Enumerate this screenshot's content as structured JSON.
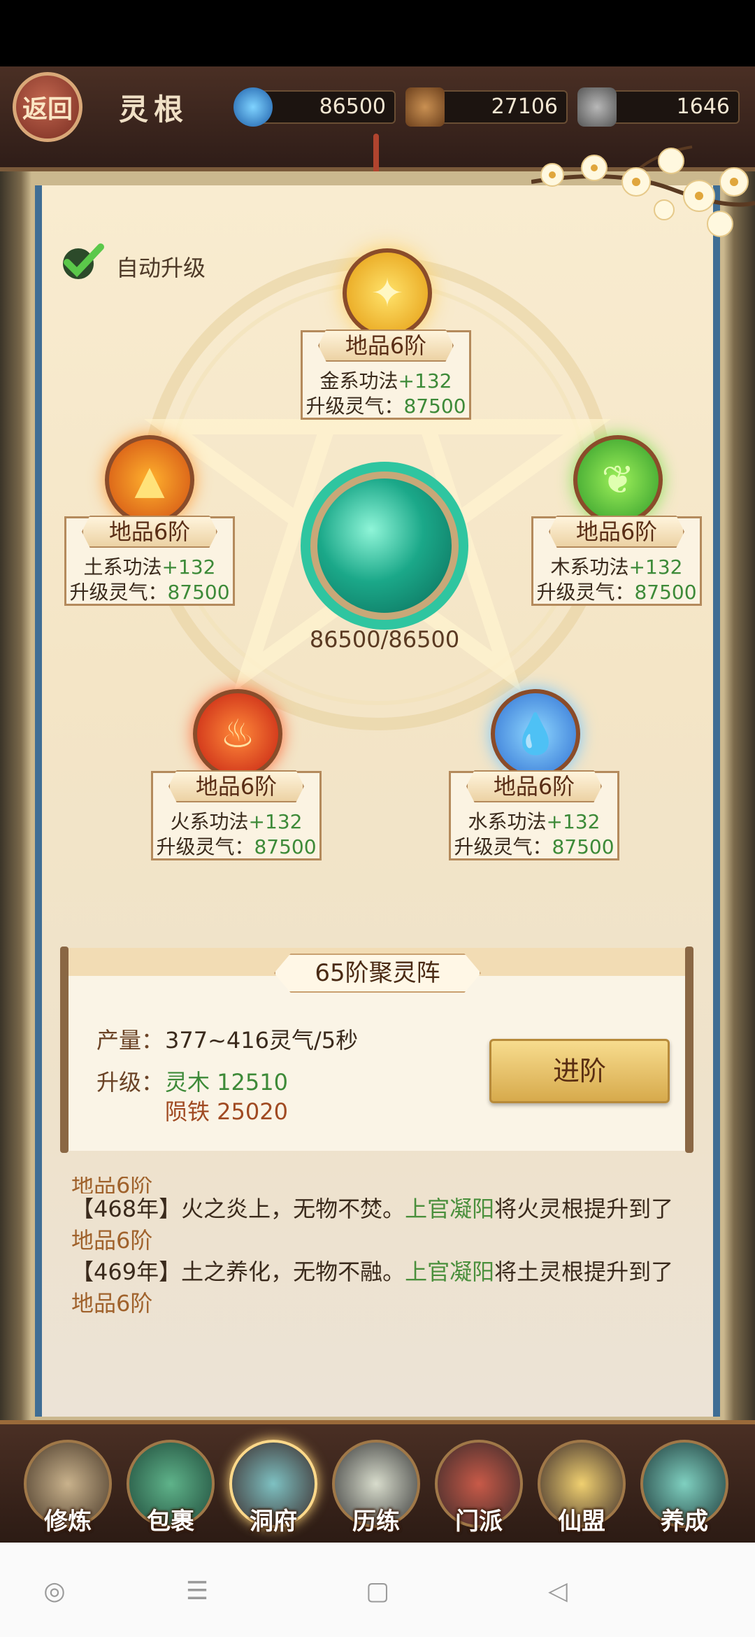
{
  "header": {
    "back_label": "返回",
    "title": "灵根",
    "resources": [
      {
        "icon": "spirit-flame-icon",
        "value": "86500"
      },
      {
        "icon": "spirit-wood-icon",
        "value": "27106"
      },
      {
        "icon": "meteor-iron-icon",
        "value": "1646"
      }
    ]
  },
  "auto_upgrade": {
    "label": "自动升级",
    "checked": true
  },
  "core": {
    "value": "86500/86500",
    "fill_fraction": 1.0
  },
  "roots": {
    "gold": {
      "tier": "地品6阶",
      "skill": "金系功法",
      "bonus": "+132",
      "cost_label": "升级灵气：",
      "cost": "87500"
    },
    "earth": {
      "tier": "地品6阶",
      "skill": "土系功法",
      "bonus": "+132",
      "cost_label": "升级灵气：",
      "cost": "87500"
    },
    "wood": {
      "tier": "地品6阶",
      "skill": "木系功法",
      "bonus": "+132",
      "cost_label": "升级灵气：",
      "cost": "87500"
    },
    "fire": {
      "tier": "地品6阶",
      "skill": "火系功法",
      "bonus": "+132",
      "cost_label": "升级灵气：",
      "cost": "87500"
    },
    "water": {
      "tier": "地品6阶",
      "skill": "水系功法",
      "bonus": "+132",
      "cost_label": "升级灵气：",
      "cost": "87500"
    }
  },
  "array": {
    "title": "65阶聚灵阵",
    "production_label": "产量：",
    "production_value": "377~416灵气/5秒",
    "upgrade_label": "升级：",
    "cost_wood": "灵木 12510",
    "cost_iron": "陨铁 25020",
    "advance_button": "进阶"
  },
  "log": {
    "cut_line": "地品6阶",
    "entries": [
      {
        "year": "【468年】",
        "text": "火之炎上，无物不焚。",
        "name": "上官凝阳",
        "action": "将火灵根提升到了",
        "tier": "地品6阶"
      },
      {
        "year": "【469年】",
        "text": "土之养化，无物不融。",
        "name": "上官凝阳",
        "action": "将土灵根提升到了",
        "tier": "地品6阶"
      }
    ]
  },
  "nav": {
    "items": [
      {
        "label": "修炼",
        "icon": "cultivator-icon"
      },
      {
        "label": "包裹",
        "icon": "bag-icon"
      },
      {
        "label": "洞府",
        "icon": "cave-palace-icon"
      },
      {
        "label": "历练",
        "icon": "scroll-icon"
      },
      {
        "label": "门派",
        "icon": "sect-gate-icon"
      },
      {
        "label": "仙盟",
        "icon": "alliance-icon"
      },
      {
        "label": "养成",
        "icon": "pentagram-icon"
      }
    ],
    "active": "洞府"
  },
  "colors": {
    "header_bg": "#3a2520",
    "accent_green": "#3d8a38",
    "panel_bg": "#f6e9cf"
  }
}
